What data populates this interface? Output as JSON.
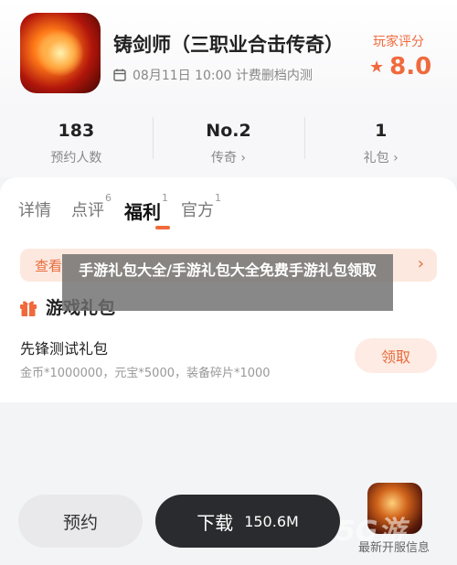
{
  "game": {
    "title": "铸剑师（三职业合击传奇）",
    "status": "08月11日 10:00 计费删档内测",
    "rating_label": "玩家评分",
    "rating_value": "8.0"
  },
  "stats": [
    {
      "value": "183",
      "label": "预约人数"
    },
    {
      "value": "No.2",
      "label": "传奇 ›"
    },
    {
      "value": "1",
      "label": "礼包 ›"
    }
  ],
  "tabs": [
    {
      "label": "详情",
      "badge": ""
    },
    {
      "label": "点评",
      "badge": "6"
    },
    {
      "label": "福利",
      "badge": "1"
    },
    {
      "label": "官方",
      "badge": "1"
    }
  ],
  "notice": {
    "text": "查看",
    "chevron": "›"
  },
  "section": {
    "title": "游戏礼包"
  },
  "gift_pack": {
    "name": "先锋测试礼包",
    "desc": "金币*1000000，元宝*5000，装备碎片*1000",
    "claim_label": "领取"
  },
  "overlay": {
    "text": "手游礼包大全/手游礼包大全免费手游礼包领取"
  },
  "bottom": {
    "reserve_label": "预约",
    "download_label": "下载",
    "download_size": "150.6M",
    "news_label": "最新开服信息",
    "watermark": "5G游"
  },
  "colors": {
    "accent": "#f06a3c",
    "dark_button": "#2a2b2e"
  }
}
